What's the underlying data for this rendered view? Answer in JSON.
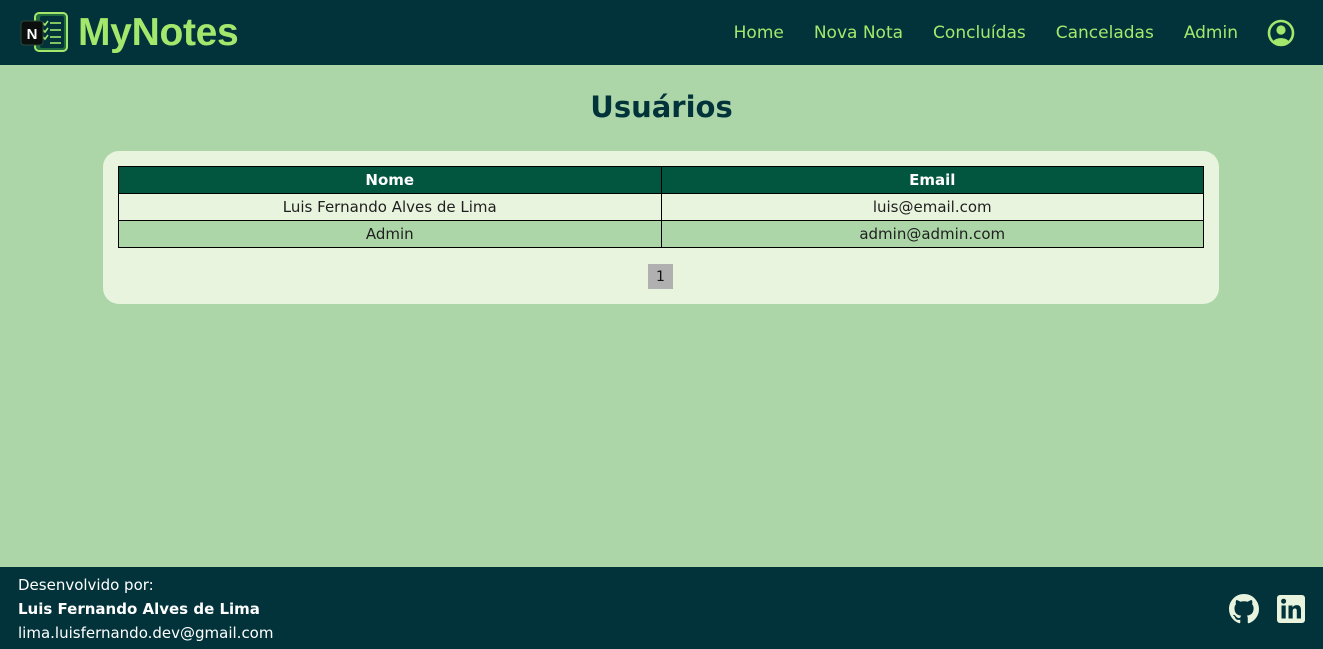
{
  "header": {
    "logo_letter": "N",
    "brand": "MyNotes",
    "nav": {
      "home": "Home",
      "new_note": "Nova Nota",
      "completed": "Concluídas",
      "cancelled": "Canceladas",
      "admin": "Admin"
    },
    "user_icon": "user-circle-icon"
  },
  "main": {
    "title": "Usuários",
    "table": {
      "columns": [
        "Nome",
        "Email"
      ],
      "rows": [
        [
          "Luis Fernando Alves de Lima",
          "luis@email.com"
        ],
        [
          "Admin",
          "admin@admin.com"
        ]
      ]
    },
    "pagination": {
      "current_page": "1"
    }
  },
  "footer": {
    "developed_by_label": "Desenvolvido por:",
    "author": "Luis Fernando Alves de Lima",
    "email": "lima.luisfernando.dev@gmail.com",
    "social_icons": [
      "github-icon",
      "linkedin-icon"
    ]
  },
  "colors": {
    "header_bg": "#02333a",
    "accent_green": "#a3e86c",
    "page_bg": "#acd6a8",
    "card_bg": "#e8f4de",
    "table_header_bg": "#02553f"
  }
}
